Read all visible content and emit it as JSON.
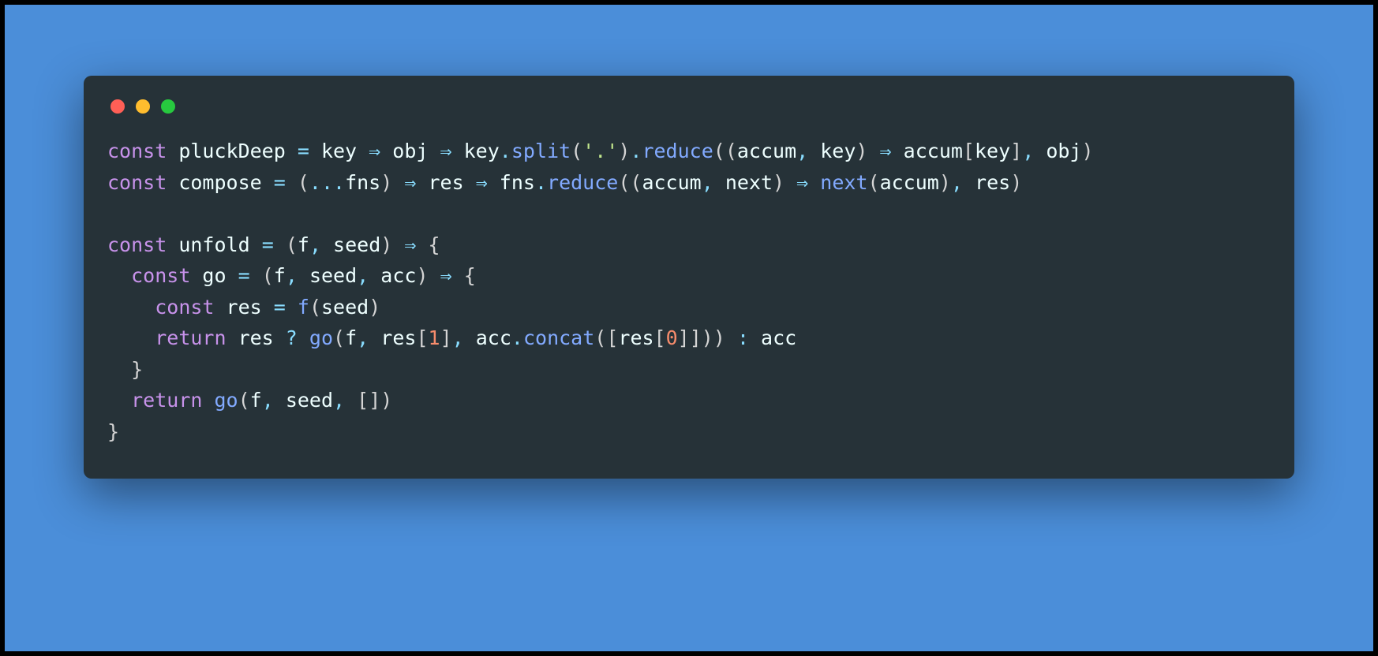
{
  "colors": {
    "canvas_bg": "#4b8ed9",
    "window_bg": "#263238",
    "dot_red": "#ff5f56",
    "dot_yellow": "#ffbd2e",
    "dot_green": "#27c93f",
    "token_keyword": "#c792ea",
    "token_function": "#82aaff",
    "token_identifier": "#eeffff",
    "token_operator": "#89ddff",
    "token_paren": "#d4d4d4",
    "token_string": "#c3e88d",
    "token_number": "#f78c6c"
  },
  "code_plain": "const pluckDeep = key => obj => key.split('.').reduce((accum, key) => accum[key], obj)\nconst compose = (...fns) => res => fns.reduce((accum, next) => next(accum), res)\n\nconst unfold = (f, seed) => {\n  const go = (f, seed, acc) => {\n    const res = f(seed)\n    return res ? go(f, res[1], acc.concat([res[0]])) : acc\n  }\n  return go(f, seed, [])\n}",
  "code_lines": [
    [
      {
        "c": "kw",
        "t": "const"
      },
      {
        "c": "id",
        "t": " pluckDeep "
      },
      {
        "c": "op",
        "t": "="
      },
      {
        "c": "id",
        "t": " key "
      },
      {
        "c": "op",
        "t": "⇒"
      },
      {
        "c": "id",
        "t": " obj "
      },
      {
        "c": "op",
        "t": "⇒"
      },
      {
        "c": "id",
        "t": " key"
      },
      {
        "c": "op",
        "t": "."
      },
      {
        "c": "fn",
        "t": "split"
      },
      {
        "c": "par",
        "t": "("
      },
      {
        "c": "str",
        "t": "'.'"
      },
      {
        "c": "par",
        "t": ")"
      },
      {
        "c": "op",
        "t": "."
      },
      {
        "c": "fn",
        "t": "reduce"
      },
      {
        "c": "par",
        "t": "(("
      },
      {
        "c": "id",
        "t": "accum"
      },
      {
        "c": "op",
        "t": ","
      },
      {
        "c": "id",
        "t": " key"
      },
      {
        "c": "par",
        "t": ")"
      },
      {
        "c": "id",
        "t": " "
      },
      {
        "c": "op",
        "t": "⇒"
      },
      {
        "c": "id",
        "t": " accum"
      },
      {
        "c": "par",
        "t": "["
      },
      {
        "c": "id",
        "t": "key"
      },
      {
        "c": "par",
        "t": "]"
      },
      {
        "c": "op",
        "t": ","
      },
      {
        "c": "id",
        "t": " obj"
      },
      {
        "c": "par",
        "t": ")"
      }
    ],
    [
      {
        "c": "kw",
        "t": "const"
      },
      {
        "c": "id",
        "t": " compose "
      },
      {
        "c": "op",
        "t": "="
      },
      {
        "c": "id",
        "t": " "
      },
      {
        "c": "par",
        "t": "("
      },
      {
        "c": "op",
        "t": "..."
      },
      {
        "c": "id",
        "t": "fns"
      },
      {
        "c": "par",
        "t": ")"
      },
      {
        "c": "id",
        "t": " "
      },
      {
        "c": "op",
        "t": "⇒"
      },
      {
        "c": "id",
        "t": " res "
      },
      {
        "c": "op",
        "t": "⇒"
      },
      {
        "c": "id",
        "t": " fns"
      },
      {
        "c": "op",
        "t": "."
      },
      {
        "c": "fn",
        "t": "reduce"
      },
      {
        "c": "par",
        "t": "(("
      },
      {
        "c": "id",
        "t": "accum"
      },
      {
        "c": "op",
        "t": ","
      },
      {
        "c": "id",
        "t": " next"
      },
      {
        "c": "par",
        "t": ")"
      },
      {
        "c": "id",
        "t": " "
      },
      {
        "c": "op",
        "t": "⇒"
      },
      {
        "c": "id",
        "t": " "
      },
      {
        "c": "fn",
        "t": "next"
      },
      {
        "c": "par",
        "t": "("
      },
      {
        "c": "id",
        "t": "accum"
      },
      {
        "c": "par",
        "t": ")"
      },
      {
        "c": "op",
        "t": ","
      },
      {
        "c": "id",
        "t": " res"
      },
      {
        "c": "par",
        "t": ")"
      }
    ],
    [],
    [
      {
        "c": "kw",
        "t": "const"
      },
      {
        "c": "id",
        "t": " unfold "
      },
      {
        "c": "op",
        "t": "="
      },
      {
        "c": "id",
        "t": " "
      },
      {
        "c": "par",
        "t": "("
      },
      {
        "c": "id",
        "t": "f"
      },
      {
        "c": "op",
        "t": ","
      },
      {
        "c": "id",
        "t": " seed"
      },
      {
        "c": "par",
        "t": ")"
      },
      {
        "c": "id",
        "t": " "
      },
      {
        "c": "op",
        "t": "⇒"
      },
      {
        "c": "id",
        "t": " "
      },
      {
        "c": "par",
        "t": "{"
      }
    ],
    [
      {
        "c": "id",
        "t": "  "
      },
      {
        "c": "kw",
        "t": "const"
      },
      {
        "c": "id",
        "t": " go "
      },
      {
        "c": "op",
        "t": "="
      },
      {
        "c": "id",
        "t": " "
      },
      {
        "c": "par",
        "t": "("
      },
      {
        "c": "id",
        "t": "f"
      },
      {
        "c": "op",
        "t": ","
      },
      {
        "c": "id",
        "t": " seed"
      },
      {
        "c": "op",
        "t": ","
      },
      {
        "c": "id",
        "t": " acc"
      },
      {
        "c": "par",
        "t": ")"
      },
      {
        "c": "id",
        "t": " "
      },
      {
        "c": "op",
        "t": "⇒"
      },
      {
        "c": "id",
        "t": " "
      },
      {
        "c": "par",
        "t": "{"
      }
    ],
    [
      {
        "c": "id",
        "t": "    "
      },
      {
        "c": "kw",
        "t": "const"
      },
      {
        "c": "id",
        "t": " res "
      },
      {
        "c": "op",
        "t": "="
      },
      {
        "c": "id",
        "t": " "
      },
      {
        "c": "fn",
        "t": "f"
      },
      {
        "c": "par",
        "t": "("
      },
      {
        "c": "id",
        "t": "seed"
      },
      {
        "c": "par",
        "t": ")"
      }
    ],
    [
      {
        "c": "id",
        "t": "    "
      },
      {
        "c": "kw",
        "t": "return"
      },
      {
        "c": "id",
        "t": " res "
      },
      {
        "c": "op",
        "t": "?"
      },
      {
        "c": "id",
        "t": " "
      },
      {
        "c": "fn",
        "t": "go"
      },
      {
        "c": "par",
        "t": "("
      },
      {
        "c": "id",
        "t": "f"
      },
      {
        "c": "op",
        "t": ","
      },
      {
        "c": "id",
        "t": " res"
      },
      {
        "c": "par",
        "t": "["
      },
      {
        "c": "num",
        "t": "1"
      },
      {
        "c": "par",
        "t": "]"
      },
      {
        "c": "op",
        "t": ","
      },
      {
        "c": "id",
        "t": " acc"
      },
      {
        "c": "op",
        "t": "."
      },
      {
        "c": "fn",
        "t": "concat"
      },
      {
        "c": "par",
        "t": "(["
      },
      {
        "c": "id",
        "t": "res"
      },
      {
        "c": "par",
        "t": "["
      },
      {
        "c": "num",
        "t": "0"
      },
      {
        "c": "par",
        "t": "]])) "
      },
      {
        "c": "op",
        "t": ":"
      },
      {
        "c": "id",
        "t": " acc"
      }
    ],
    [
      {
        "c": "id",
        "t": "  "
      },
      {
        "c": "par",
        "t": "}"
      }
    ],
    [
      {
        "c": "id",
        "t": "  "
      },
      {
        "c": "kw",
        "t": "return"
      },
      {
        "c": "id",
        "t": " "
      },
      {
        "c": "fn",
        "t": "go"
      },
      {
        "c": "par",
        "t": "("
      },
      {
        "c": "id",
        "t": "f"
      },
      {
        "c": "op",
        "t": ","
      },
      {
        "c": "id",
        "t": " seed"
      },
      {
        "c": "op",
        "t": ","
      },
      {
        "c": "id",
        "t": " "
      },
      {
        "c": "par",
        "t": "[])"
      }
    ],
    [
      {
        "c": "par",
        "t": "}"
      }
    ]
  ]
}
